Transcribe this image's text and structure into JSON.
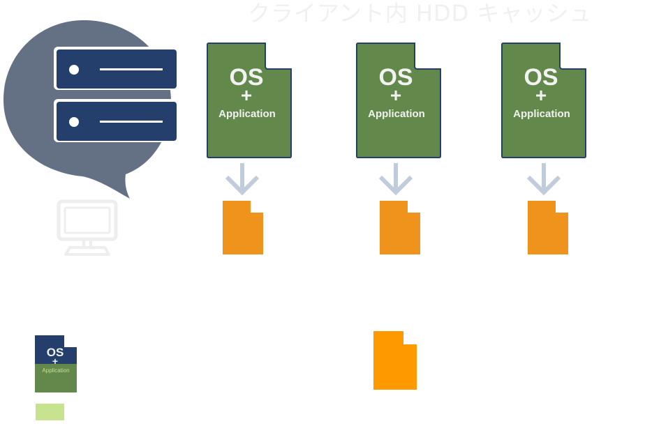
{
  "title": "クライアント内 HDD キャッシュ",
  "colors": {
    "bubble": "#647184",
    "server": "#243f6b",
    "doc_green": "#62884b",
    "doc_border": "#243f6b",
    "arrow": "#c0cbdb",
    "cache_orange": "#f0931c",
    "legend_orange": "#ff9900",
    "legend_swatch": "#c8e38e",
    "monitor": "#eeeeee"
  },
  "icons": {
    "server": "server-stack-icon",
    "client": "monitor-icon",
    "arrow": "arrow-down-icon",
    "cache": "cache-file-icon"
  },
  "clients": [
    {
      "os": "OS",
      "plus": "+",
      "app": "Application"
    },
    {
      "os": "OS",
      "plus": "+",
      "app": "Application"
    },
    {
      "os": "OS",
      "plus": "+",
      "app": "Application"
    }
  ],
  "legend": {
    "image": {
      "os": "OS",
      "plus": "+",
      "app": "Application"
    }
  }
}
